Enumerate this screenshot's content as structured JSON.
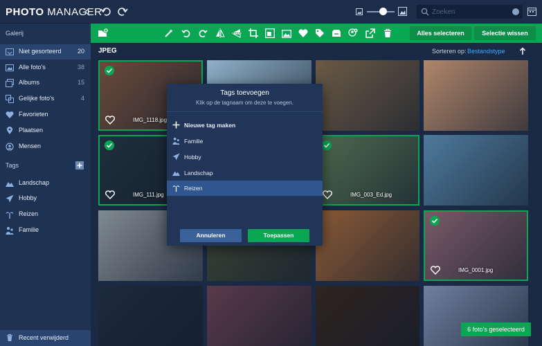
{
  "app": {
    "title_bold": "PHOTO",
    "title_rest": " MANAGER"
  },
  "search": {
    "placeholder": "Zoeken"
  },
  "sidebar": {
    "gallery_label": "Galerij",
    "items": [
      {
        "label": "Niet gesorteerd",
        "count": "20",
        "icon": "inbox-icon",
        "active": true
      },
      {
        "label": "Alle foto's",
        "count": "38",
        "icon": "image-icon"
      },
      {
        "label": "Albums",
        "count": "15",
        "icon": "album-icon"
      },
      {
        "label": "Gelijke foto's",
        "count": "4",
        "icon": "duplicate-icon"
      },
      {
        "label": "Favorieten",
        "count": "",
        "icon": "heart-icon"
      },
      {
        "label": "Plaatsen",
        "count": "",
        "icon": "location-icon"
      },
      {
        "label": "Mensen",
        "count": "",
        "icon": "face-icon"
      }
    ],
    "tags_label": "Tags",
    "tags": [
      {
        "label": "Landschap",
        "icon": "landscape-icon"
      },
      {
        "label": "Hobby",
        "icon": "paper-plane-icon"
      },
      {
        "label": "Reizen",
        "icon": "palm-tree-icon"
      },
      {
        "label": "Familie",
        "icon": "family-icon"
      }
    ],
    "recent_deleted": "Recent verwijderd"
  },
  "toolbar": {
    "select_all": "Alles selecteren",
    "clear_selection": "Selectie wissen"
  },
  "grid": {
    "title": "JPEG",
    "sort_label": "Sorteren op:",
    "sort_value": "Bestandstype",
    "tiles": [
      {
        "filename": "IMG_1118.jpg",
        "selected": true,
        "bg": "#6a4a3a"
      },
      {
        "filename": "",
        "selected": false,
        "bg": "#8fb0c8"
      },
      {
        "filename": "",
        "selected": false,
        "bg": "#6b5a45"
      },
      {
        "filename": "",
        "selected": false,
        "bg": "#b0866a"
      },
      {
        "filename": "IMG_111.jpg",
        "selected": true,
        "bg": "#1f2f3c"
      },
      {
        "filename": "",
        "selected": false,
        "bg": "#3a4a56"
      },
      {
        "filename": "IMG_003_Ed.jpg",
        "selected": true,
        "bg": "#4f6a4f"
      },
      {
        "filename": "",
        "selected": false,
        "bg": "#4e7a9c"
      },
      {
        "filename": "",
        "selected": false,
        "bg": "#7f8a92"
      },
      {
        "filename": "",
        "selected": false,
        "bg": "#3a4537"
      },
      {
        "filename": "",
        "selected": false,
        "bg": "#8a5a36"
      },
      {
        "filename": "IMG_0001.jpg",
        "selected": true,
        "bg": "#7a5a66"
      },
      {
        "filename": "",
        "selected": false,
        "bg": "#1d2a3a"
      },
      {
        "filename": "",
        "selected": false,
        "bg": "#5a3a4a"
      },
      {
        "filename": "",
        "selected": false,
        "bg": "#2f2420"
      },
      {
        "filename": "",
        "selected": false,
        "bg": "#6f7f9f"
      }
    ]
  },
  "dialog": {
    "title": "Tags toevoegen",
    "subtitle": "Klik op de tagnaam om deze te voegen.",
    "items": [
      {
        "label": "Nieuwe tag maken",
        "icon": "plus-icon"
      },
      {
        "label": "Familie",
        "icon": "family-icon"
      },
      {
        "label": "Hobby",
        "icon": "paper-plane-icon"
      },
      {
        "label": "Landschap",
        "icon": "landscape-icon"
      },
      {
        "label": "Reizen",
        "icon": "palm-tree-icon"
      }
    ],
    "cancel": "Annuleren",
    "apply": "Toepassen"
  },
  "status": {
    "selected_badge": "6 foto's geselecteerd"
  },
  "colors": {
    "accent_green": "#0aa654",
    "link_blue": "#39a9ff",
    "panel": "#1e3253"
  }
}
